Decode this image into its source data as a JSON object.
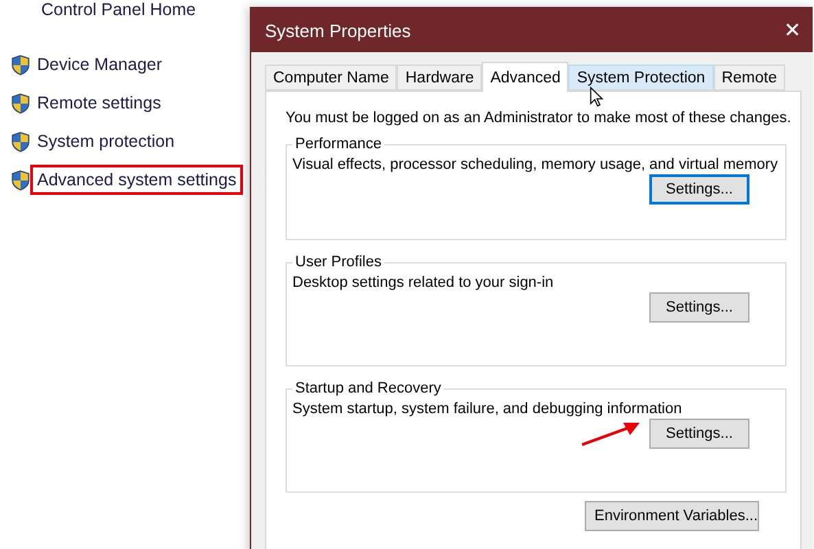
{
  "sidebar": {
    "home": "Control Panel Home",
    "items": [
      {
        "label": "Device Manager",
        "highlighted": false
      },
      {
        "label": "Remote settings",
        "highlighted": false
      },
      {
        "label": "System protection",
        "highlighted": false
      },
      {
        "label": "Advanced system settings",
        "highlighted": true
      }
    ]
  },
  "dialog": {
    "title": "System Properties",
    "close": "✕",
    "tabs": [
      {
        "label": "Computer Name",
        "selected": false,
        "hovered": false
      },
      {
        "label": "Hardware",
        "selected": false,
        "hovered": false
      },
      {
        "label": "Advanced",
        "selected": true,
        "hovered": false
      },
      {
        "label": "System Protection",
        "selected": false,
        "hovered": true
      },
      {
        "label": "Remote",
        "selected": false,
        "hovered": false
      }
    ],
    "notice": "You must be logged on as an Administrator to make most of these changes.",
    "groups": [
      {
        "title": "Performance",
        "description": "Visual effects, processor scheduling, memory usage, and virtual memory",
        "button": "Settings...",
        "focused": true,
        "arrow": false
      },
      {
        "title": "User Profiles",
        "description": "Desktop settings related to your sign-in",
        "button": "Settings...",
        "focused": false,
        "arrow": false
      },
      {
        "title": "Startup and Recovery",
        "description": "System startup, system failure, and debugging information",
        "button": "Settings...",
        "focused": false,
        "arrow": true
      }
    ],
    "bottom_button": "Environment Variables..."
  }
}
